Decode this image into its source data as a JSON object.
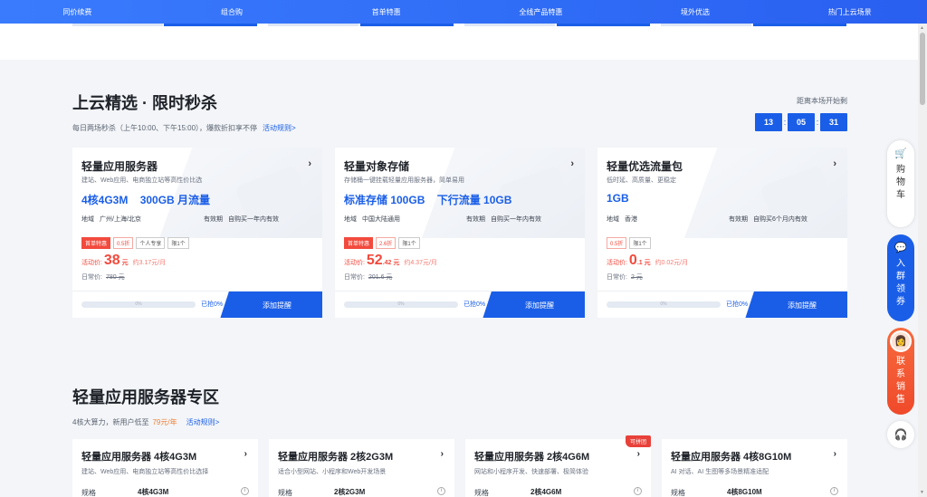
{
  "nav": [
    "同价续费",
    "组合购",
    "首单特惠",
    "全线产品特惠",
    "境外优选",
    "热门上云场景"
  ],
  "flash": {
    "title": "上云精选 · 限时秒杀",
    "subtitle": "每日两场秒杀（上午10:00、下午15:00），爆款折扣享不停",
    "rules_link": "活动规则>",
    "countdown_label": "距离本场开始剩",
    "countdown": [
      "13",
      "05",
      "31"
    ],
    "cards": [
      {
        "title": "轻量应用服务器",
        "desc": "建站、Web应用、电商独立站等高性价比选",
        "spec": "4核4G3M    300GB 月流量",
        "region_label": "地域",
        "region": "广州/上海/北京",
        "validity_label": "有效期",
        "validity": "自购买一年内有效",
        "tags": [
          "首单特惠",
          "0.5折",
          "个人专享",
          "限1个"
        ],
        "price_label": "活动价:",
        "price": "38",
        "unit": "元",
        "per_month": "约3.17元/月",
        "orig_label": "日常价:",
        "orig": "780 元",
        "progress": "0%",
        "sold": "已抢0%",
        "button": "添加提醒"
      },
      {
        "title": "轻量对象存储",
        "desc": "存储桶一键挂载轻量应用服务器，简单易用",
        "spec": "标准存储 100GB    下行流量 10GB",
        "region_label": "地域",
        "region": "中国大陆通用",
        "validity_label": "有效期",
        "validity": "自购买一年内有效",
        "tags": [
          "首单特惠",
          "2.6折",
          "限1个"
        ],
        "price_label": "活动价:",
        "price": "52",
        "unit": ".42 元",
        "per_month": "约4.37元/月",
        "orig_label": "日常价:",
        "orig": "201.6 元",
        "progress": "0%",
        "sold": "已抢0%",
        "button": "添加提醒"
      },
      {
        "title": "轻量优选流量包",
        "desc": "低时延、高质量、更稳定",
        "spec": "1GB",
        "region_label": "地域",
        "region": "香港",
        "validity_label": "有效期",
        "validity": "自购买6个月内有效",
        "tags": [
          "0.5折",
          "限1个"
        ],
        "price_label": "活动价:",
        "price": "0",
        "unit": ".1 元",
        "per_month": "约0.02元/月",
        "orig_label": "日常价:",
        "orig": "2 元",
        "progress": "0%",
        "sold": "已抢0%",
        "button": "添加提醒"
      }
    ]
  },
  "lighthouse": {
    "title": "轻量应用服务器专区",
    "subtitle_pre": "4核大算力，新用户低至",
    "subtitle_price": "79元/年",
    "rules_link": "活动规则>",
    "cards": [
      {
        "title": "轻量应用服务器 4核4G3M",
        "desc": "建站、Web应用、电商独立站等高性价比选择",
        "spec_label": "规格",
        "spec": "4核4G3M",
        "badge": ""
      },
      {
        "title": "轻量应用服务器 2核2G3M",
        "desc": "适合小型网站、小程序和Web开发场景",
        "spec_label": "规格",
        "spec": "2核2G3M",
        "badge": ""
      },
      {
        "title": "轻量应用服务器 2核4G6M",
        "desc": "网站和小程序开发、快速部署、极简体验",
        "spec_label": "规格",
        "spec": "2核4G6M",
        "badge": "可拼团"
      },
      {
        "title": "轻量应用服务器 4核8G10M",
        "desc": "AI 对话、AI 生图等多场景精准适配",
        "spec_label": "规格",
        "spec": "4核8G10M",
        "badge": ""
      }
    ]
  },
  "floating": {
    "cart": [
      "购",
      "物",
      "车"
    ],
    "group": [
      "入",
      "群",
      "领",
      "券"
    ],
    "sales": [
      "联",
      "系",
      "销",
      "售"
    ]
  },
  "colors": {
    "brand": "#1a5ee8",
    "price": "#f24a3d",
    "accent_orange": "#f2823a"
  }
}
